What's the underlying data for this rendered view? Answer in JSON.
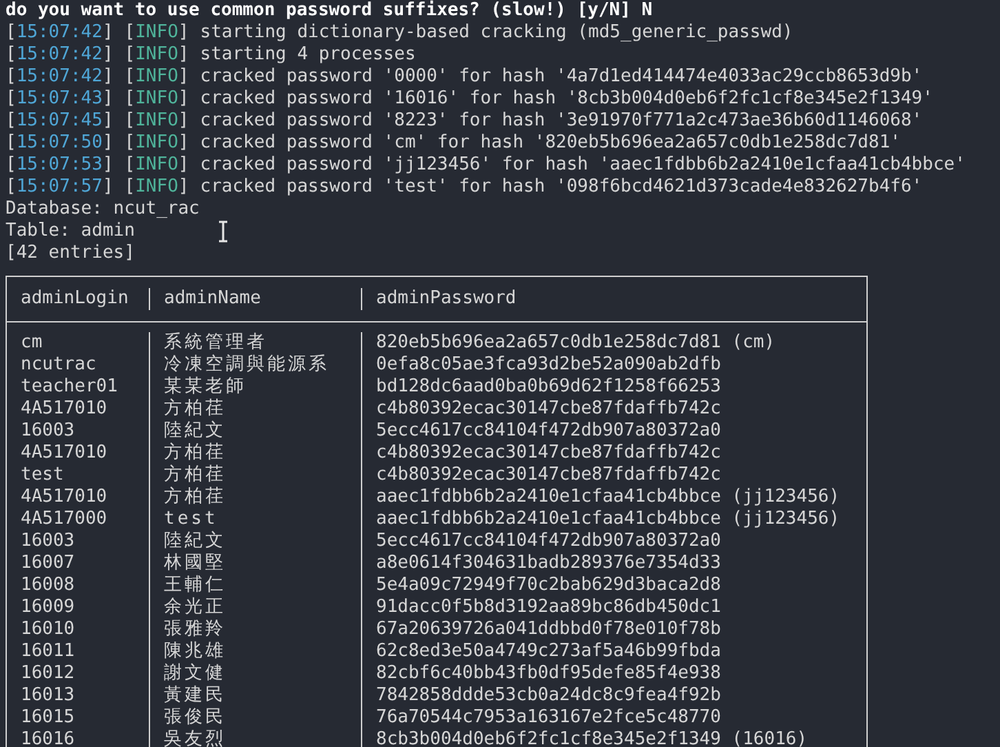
{
  "prompt": "do you want to use common password suffixes? (slow!) [y/N] N",
  "log": [
    {
      "time": "[15:07:42]",
      "level": "[INFO]",
      "message": "starting dictionary-based cracking (md5_generic_passwd)"
    },
    {
      "time": "[15:07:42]",
      "level": "[INFO]",
      "message": "starting 4 processes"
    },
    {
      "time": "[15:07:42]",
      "level": "[INFO]",
      "message": "cracked password '0000' for hash '4a7d1ed414474e4033ac29ccb8653d9b'"
    },
    {
      "time": "[15:07:43]",
      "level": "[INFO]",
      "message": "cracked password '16016' for hash '8cb3b004d0eb6f2fc1cf8e345e2f1349'"
    },
    {
      "time": "[15:07:45]",
      "level": "[INFO]",
      "message": "cracked password '8223' for hash '3e91970f771a2c473ae36b60d1146068'"
    },
    {
      "time": "[15:07:50]",
      "level": "[INFO]",
      "message": "cracked password 'cm' for hash '820eb5b696ea2a657c0db1e258dc7d81'"
    },
    {
      "time": "[15:07:53]",
      "level": "[INFO]",
      "message": "cracked password 'jj123456' for hash 'aaec1fdbb6b2a2410e1cfaa41cb4bbce'"
    },
    {
      "time": "[15:07:57]",
      "level": "[INFO]",
      "message": "cracked password 'test' for hash '098f6bcd4621d373cade4e832627b4f6'"
    }
  ],
  "summary": [
    "Database: ncut_rac",
    "Table: admin",
    "[42 entries]"
  ],
  "table": {
    "columns": [
      "adminLogin",
      "adminName",
      "adminPassword"
    ],
    "rows": [
      [
        "cm",
        "系統管理者",
        "820eb5b696ea2a657c0db1e258dc7d81 (cm)"
      ],
      [
        "ncutrac",
        "冷凍空調與能源系",
        "0efa8c05ae3fca93d2be52a090ab2dfb"
      ],
      [
        "teacher01",
        "某某老師",
        "bd128dc6aad0ba0b69d62f1258f66253"
      ],
      [
        "4A517010",
        "方柏荏",
        "c4b80392ecac30147cbe87fdaffb742c"
      ],
      [
        "16003",
        "陸紀文",
        "5ecc4617cc84104f472db907a80372a0"
      ],
      [
        "4A517010",
        "方柏荏",
        "c4b80392ecac30147cbe87fdaffb742c"
      ],
      [
        "test",
        "方柏荏",
        "c4b80392ecac30147cbe87fdaffb742c"
      ],
      [
        "4A517010",
        "方柏荏",
        "aaec1fdbb6b2a2410e1cfaa41cb4bbce (jj123456)"
      ],
      [
        "4A517000",
        "test",
        "aaec1fdbb6b2a2410e1cfaa41cb4bbce (jj123456)"
      ],
      [
        "16003",
        "陸紀文",
        "5ecc4617cc84104f472db907a80372a0"
      ],
      [
        "16007",
        "林國堅",
        "a8e0614f304631badb289376e7354d33"
      ],
      [
        "16008",
        "王輔仁",
        "5e4a09c72949f70c2bab629d3baca2d8"
      ],
      [
        "16009",
        "余光正",
        "91dacc0f5b8d3192aa89bc86db450dc1"
      ],
      [
        "16010",
        "張雅羚",
        "67a20639726a041ddbbd0f78e010f78b"
      ],
      [
        "16011",
        "陳兆雄",
        "62c8ed3e50a4749c273af5a46b99fbda"
      ],
      [
        "16012",
        "謝文健",
        "82cbf6c40bb43fb0df95defe85f4e938"
      ],
      [
        "16013",
        "黃建民",
        "7842858ddde53cb0a24dc8c9fea4f92b"
      ],
      [
        "16015",
        "張俊民",
        "76a70544c7953a163167e2fce5c48770"
      ],
      [
        "16016",
        "吳友烈",
        "8cb3b004d0eb6f2fc1cf8e345e2f1349 (16016)"
      ]
    ]
  }
}
